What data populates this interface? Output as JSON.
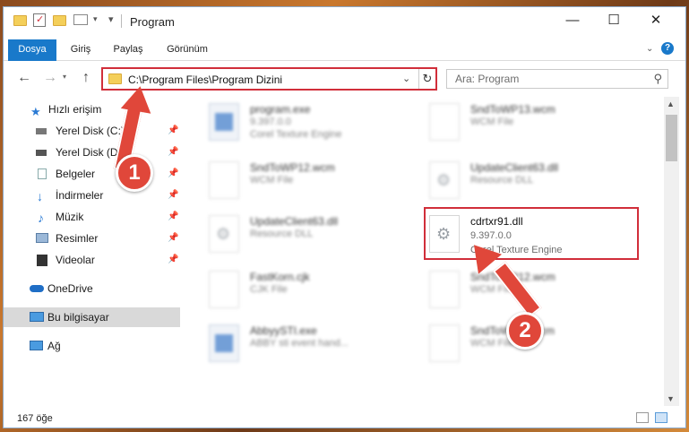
{
  "window": {
    "title": "Program",
    "controls": {
      "minimize": "—",
      "maximize": "☐",
      "close": "✕"
    }
  },
  "ribbon": {
    "tabs": [
      {
        "label": "Dosya",
        "active": true
      },
      {
        "label": "Giriş"
      },
      {
        "label": "Paylaş"
      },
      {
        "label": "Görünüm"
      }
    ],
    "help": "?"
  },
  "nav": {
    "back": "←",
    "forward": "→",
    "up": "↑",
    "path": "C:\\Program Files\\Program Dizini",
    "search_placeholder": "Ara: Program"
  },
  "sidebar": {
    "items": [
      {
        "label": "Hızlı erişim",
        "icon": "star-icon"
      },
      {
        "label": "Yerel Disk (C:)",
        "icon": "drive-icon",
        "pinned": true
      },
      {
        "label": "Yerel Disk (D:)",
        "icon": "drive-icon",
        "pinned": true
      },
      {
        "label": "Belgeler",
        "icon": "documents-icon",
        "pinned": true
      },
      {
        "label": "İndirmeler",
        "icon": "download-icon",
        "pinned": true
      },
      {
        "label": "Müzik",
        "icon": "music-icon",
        "pinned": true
      },
      {
        "label": "Resimler",
        "icon": "pictures-icon",
        "pinned": true
      },
      {
        "label": "Videolar",
        "icon": "videos-icon",
        "pinned": true
      },
      {
        "label": "OneDrive",
        "icon": "cloud-icon"
      },
      {
        "label": "Bu bilgisayar",
        "icon": "computer-icon",
        "selected": true
      },
      {
        "label": "Ağ",
        "icon": "network-icon"
      }
    ]
  },
  "files": [
    {
      "name": "program.exe",
      "line2": "9.397.0.0",
      "line3": "Corel Texture Engine",
      "kind": "exe"
    },
    {
      "name": "SndToWP13.wcm",
      "line2": "WCM File",
      "line3": "",
      "kind": "doc"
    },
    {
      "name": "SndToWP12.wcm",
      "line2": "WCM File",
      "line3": "",
      "kind": "doc"
    },
    {
      "name": "UpdateClient63.dll",
      "line2": "Resource DLL",
      "line3": "",
      "kind": "gear"
    },
    {
      "name": "UpdateClient63.dll",
      "line2": "Resource DLL",
      "line3": "",
      "kind": "gear"
    },
    {
      "name": "cdrtxr91.dll",
      "line2": "9.397.0.0",
      "line3": "Corel Texture Engine",
      "kind": "gear",
      "highlighted": true
    },
    {
      "name": "FastKorn.cjk",
      "line2": "CJK File",
      "line3": "",
      "kind": "doc"
    },
    {
      "name": "SndToWP12.wcm",
      "line2": "WCM File",
      "line3": "",
      "kind": "doc"
    },
    {
      "name": "AbbyySTI.exe",
      "line2": "ABBY sti event hand...",
      "line3": "",
      "kind": "exe"
    },
    {
      "name": "SndToWP11.wcm",
      "line2": "WCM File",
      "line3": "",
      "kind": "doc"
    }
  ],
  "status": {
    "count": "167 öğe"
  },
  "annotations": [
    {
      "label": "1"
    },
    {
      "label": "2"
    }
  ],
  "colors": {
    "accent": "#1979ca",
    "annotation": "#e0473a",
    "highlight_border": "#d12e3a"
  }
}
